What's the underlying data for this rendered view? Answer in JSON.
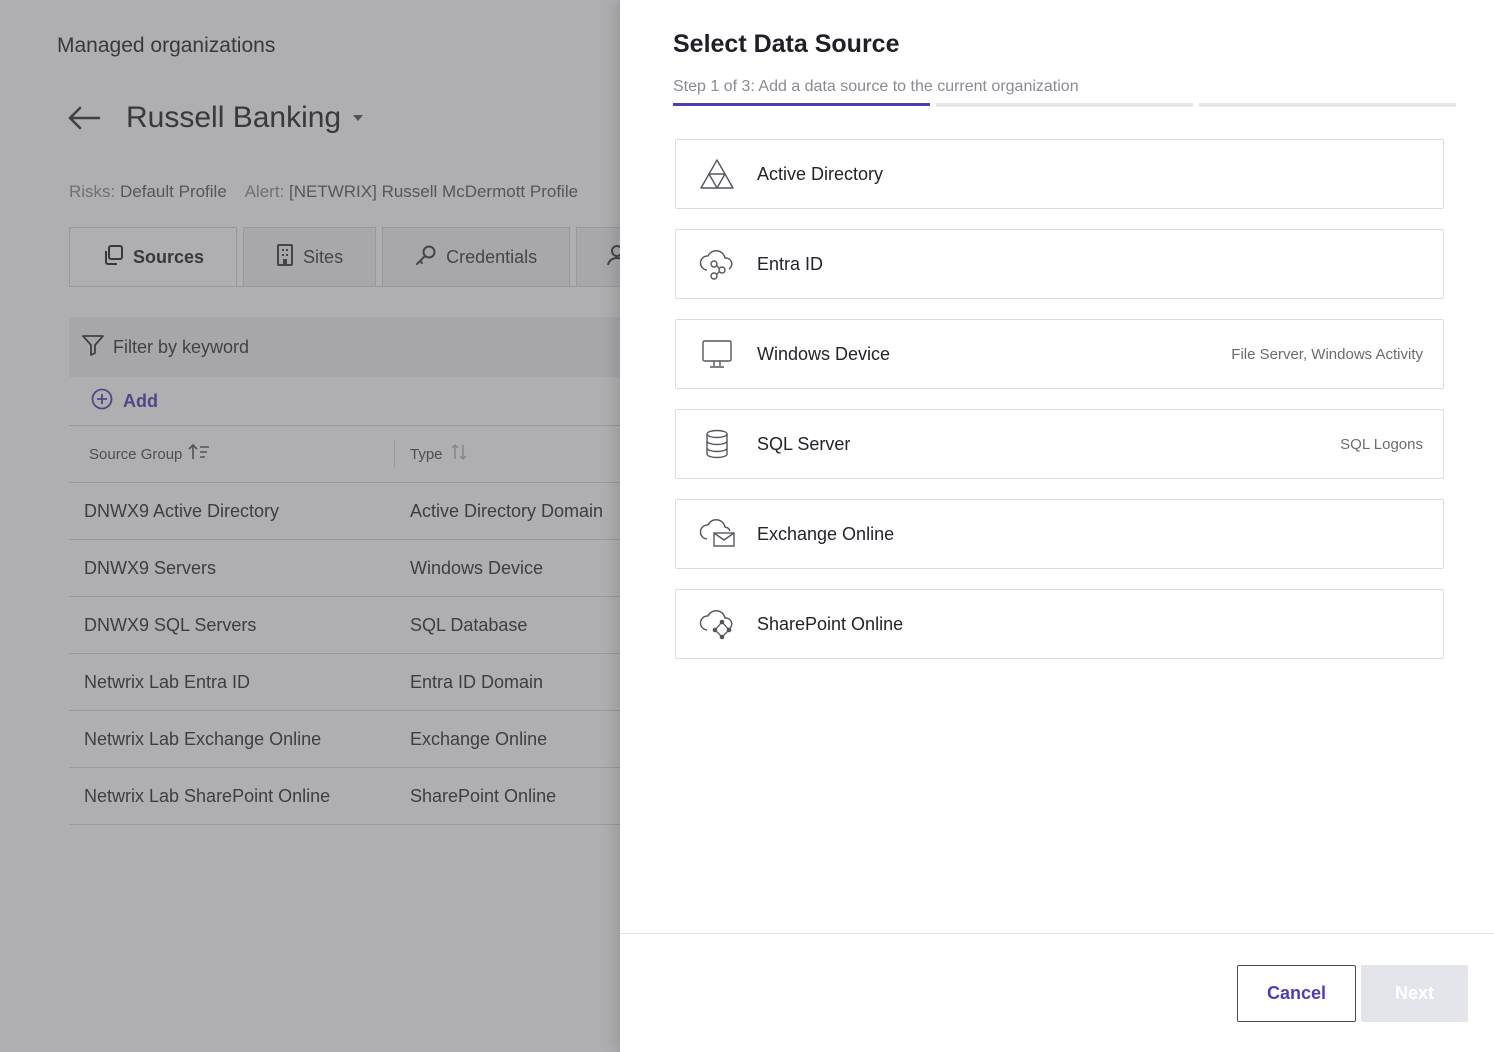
{
  "background": {
    "page_title": "Managed organizations",
    "org_name": "Russell Banking",
    "risks_label": "Risks:",
    "risks_value": "Default Profile",
    "alert_label": "Alert:",
    "alert_value": "[NETWRIX] Russell McDermott Profile",
    "tabs": [
      {
        "label": "Sources",
        "icon": "copy-icon",
        "active": true
      },
      {
        "label": "Sites",
        "icon": "building-icon",
        "active": false
      },
      {
        "label": "Credentials",
        "icon": "key-icon",
        "active": false
      }
    ],
    "filter_placeholder": "Filter by keyword",
    "add_label": "Add",
    "table": {
      "columns": [
        "Source Group",
        "Type"
      ],
      "rows": [
        [
          "DNWX9 Active Directory",
          "Active Directory Domain"
        ],
        [
          "DNWX9 Servers",
          "Windows Device"
        ],
        [
          "DNWX9 SQL Servers",
          "SQL Database"
        ],
        [
          "Netwrix Lab Entra ID",
          "Entra ID Domain"
        ],
        [
          "Netwrix Lab Exchange Online",
          "Exchange Online"
        ],
        [
          "Netwrix Lab SharePoint Online",
          "SharePoint Online"
        ]
      ]
    }
  },
  "drawer": {
    "title": "Select Data Source",
    "step_text": "Step 1 of 3: Add a data source to the current organization",
    "current_step": 1,
    "total_steps": 3,
    "accent_color": "#4b3fb3",
    "sources": [
      {
        "label": "Active Directory",
        "sub": "",
        "icon": "triangle-network-icon"
      },
      {
        "label": "Entra ID",
        "sub": "",
        "icon": "cloud-network-icon"
      },
      {
        "label": "Windows Device",
        "sub": "File Server, Windows Activity",
        "icon": "monitor-icon"
      },
      {
        "label": "SQL Server",
        "sub": "SQL Logons",
        "icon": "database-icon"
      },
      {
        "label": "Exchange Online",
        "sub": "",
        "icon": "cloud-mail-icon"
      },
      {
        "label": "SharePoint Online",
        "sub": "",
        "icon": "cloud-share-icon"
      }
    ],
    "cancel_label": "Cancel",
    "next_label": "Next"
  }
}
